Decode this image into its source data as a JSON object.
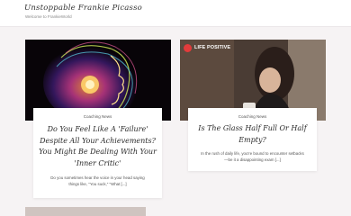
{
  "header": {
    "site_title": "Unstoppable Frankie Picasso",
    "tagline": "Welcome to FrankieWorld"
  },
  "posts": [
    {
      "category": "Coaching News",
      "title": "Do You Feel Like A 'Failure' Despite All Your Achievements? You Might Be Dealing With Your 'Inner Critic'",
      "excerpt": "Do you sometimes hear the voice in your head saying things like, \"You suck,\" \"What [...]"
    },
    {
      "category": "Coaching News",
      "title": "Is The Glass Half Full Or Half Empty?",
      "excerpt": "In the rush of daily life, you're bound to encounter setbacks—be it a disappointing exam [...]",
      "image_badge": "LIFE POSITIVE"
    }
  ]
}
